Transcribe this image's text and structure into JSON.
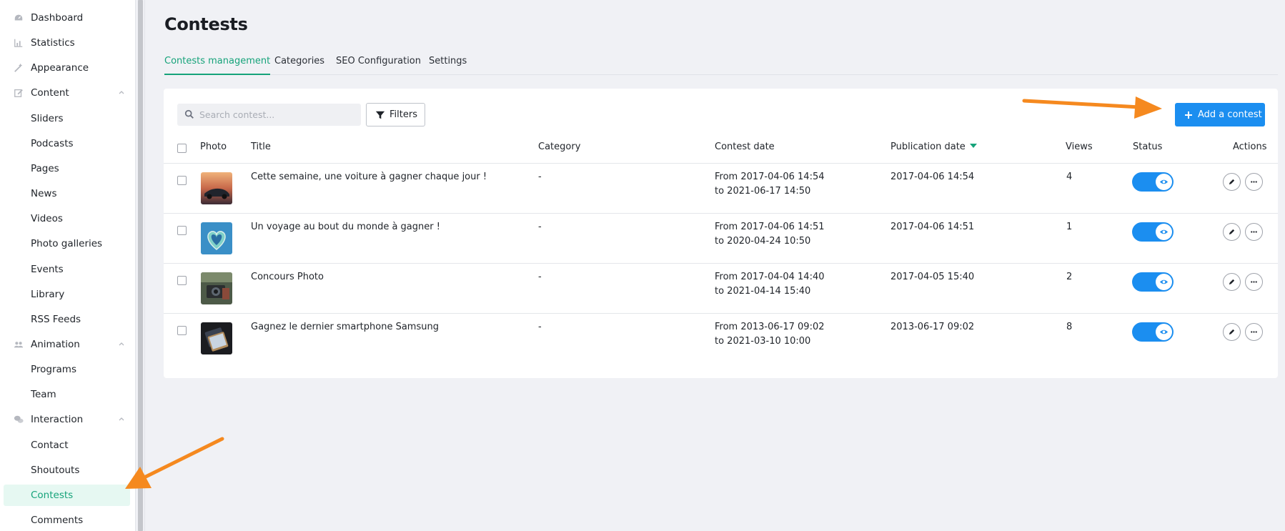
{
  "sidebar": {
    "items": [
      {
        "label": "Dashboard",
        "icon": "dashboard-icon"
      },
      {
        "label": "Statistics",
        "icon": "chart-icon"
      },
      {
        "label": "Appearance",
        "icon": "wand-icon"
      },
      {
        "label": "Content",
        "icon": "edit-icon",
        "expanded": true
      },
      {
        "label": "Sliders"
      },
      {
        "label": "Podcasts"
      },
      {
        "label": "Pages"
      },
      {
        "label": "News"
      },
      {
        "label": "Videos"
      },
      {
        "label": "Photo galleries"
      },
      {
        "label": "Events"
      },
      {
        "label": "Library"
      },
      {
        "label": "RSS Feeds"
      },
      {
        "label": "Animation",
        "icon": "users-icon",
        "expanded": true
      },
      {
        "label": "Programs"
      },
      {
        "label": "Team"
      },
      {
        "label": "Interaction",
        "icon": "chat-icon",
        "expanded": true
      },
      {
        "label": "Contact"
      },
      {
        "label": "Shoutouts"
      },
      {
        "label": "Contests",
        "active": true
      },
      {
        "label": "Comments"
      }
    ]
  },
  "page": {
    "title": "Contests"
  },
  "tabs": [
    {
      "label": "Contests management",
      "active": true
    },
    {
      "label": "Categories"
    },
    {
      "label": "SEO Configuration"
    },
    {
      "label": "Settings"
    }
  ],
  "toolbar": {
    "search_placeholder": "Search contest...",
    "search_value": "",
    "filters_label": "Filters",
    "add_label": "Add a contest"
  },
  "table": {
    "columns": {
      "photo": "Photo",
      "title": "Title",
      "category": "Category",
      "contest_date": "Contest date",
      "publication_date": "Publication date",
      "views": "Views",
      "status": "Status",
      "actions": "Actions"
    },
    "sorted_column": "publication_date",
    "rows": [
      {
        "title": "Cette semaine, une voiture à gagner chaque jour !",
        "category": "-",
        "date_from": "From 2017-04-06 14:54",
        "date_to": "to 2021-06-17 14:50",
        "publication": "2017-04-06 14:54",
        "views": "4",
        "status_on": true,
        "thumb": "car"
      },
      {
        "title": "Un voyage au bout du monde à gagner !",
        "category": "-",
        "date_from": "From 2017-04-06 14:51",
        "date_to": "to 2020-04-24 10:50",
        "publication": "2017-04-06 14:51",
        "views": "1",
        "status_on": true,
        "thumb": "island"
      },
      {
        "title": "Concours Photo",
        "category": "-",
        "date_from": "From 2017-04-04 14:40",
        "date_to": "to 2021-04-14 15:40",
        "publication": "2017-04-05 15:40",
        "views": "2",
        "status_on": true,
        "thumb": "camera"
      },
      {
        "title": "Gagnez le dernier smartphone Samsung",
        "category": "-",
        "date_from": "From 2013-06-17 09:02",
        "date_to": "to 2021-03-10 10:00",
        "publication": "2013-06-17 09:02",
        "views": "8",
        "status_on": true,
        "thumb": "phone"
      }
    ]
  },
  "colors": {
    "accent_green": "#16a37a",
    "primary_blue": "#1b8ef0",
    "annotation_orange": "#f5891f"
  }
}
